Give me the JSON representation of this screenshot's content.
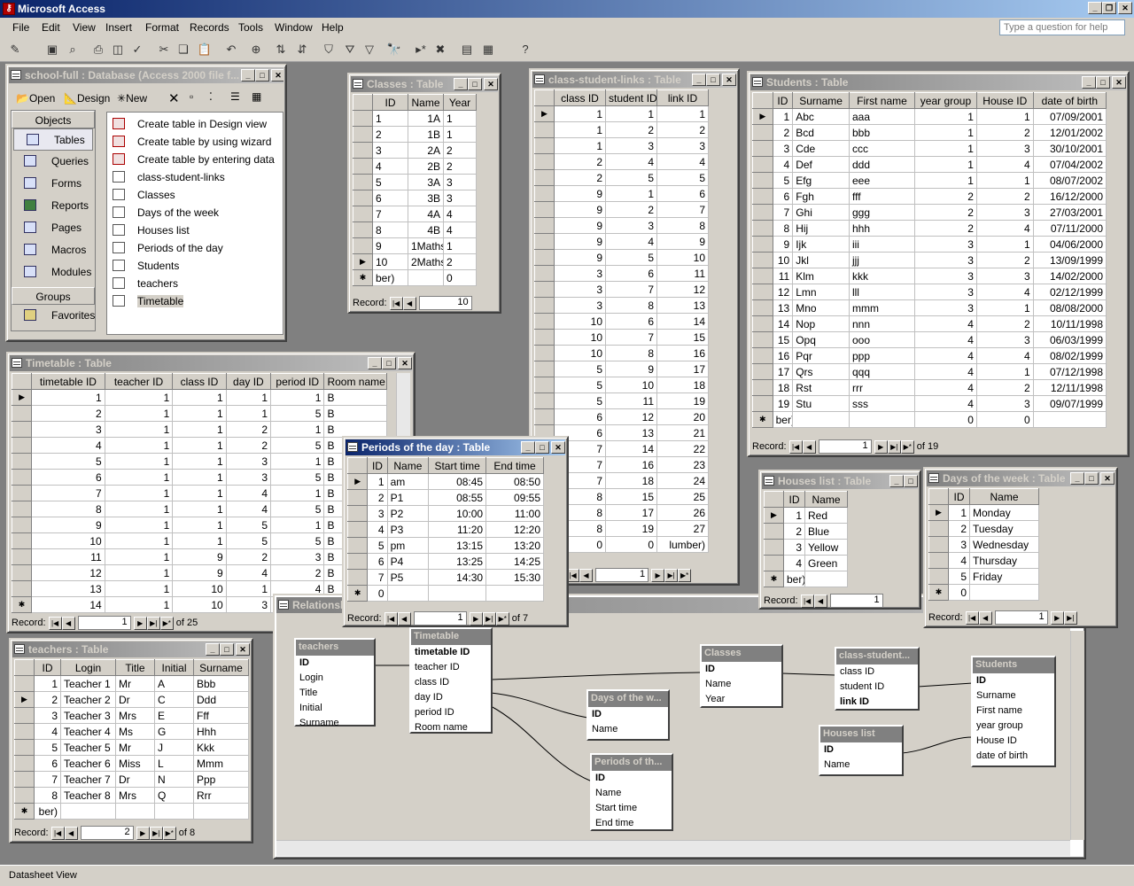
{
  "app": {
    "title": "Microsoft Access",
    "help_placeholder": "Type a question for help",
    "status": "Datasheet View"
  },
  "menu": [
    "File",
    "Edit",
    "View",
    "Insert",
    "Format",
    "Records",
    "Tools",
    "Window",
    "Help"
  ],
  "dbwindow": {
    "title": "school-full : Database (Access 2000 file f...",
    "toolbar": {
      "open": "Open",
      "design": "Design",
      "new": "New"
    },
    "objects_header": "Objects",
    "groups_header": "Groups",
    "objects": [
      "Tables",
      "Queries",
      "Forms",
      "Reports",
      "Pages",
      "Macros",
      "Modules"
    ],
    "favorites": "Favorites",
    "items": [
      "Create table in Design view",
      "Create table by using wizard",
      "Create table by entering data",
      "class-student-links",
      "Classes",
      "Days of the week",
      "Houses list",
      "Periods of the day",
      "Students",
      "teachers",
      "Timetable"
    ]
  },
  "classes": {
    "title": "Classes : Table",
    "headers": [
      "ID",
      "Name",
      "Year"
    ],
    "rows": [
      [
        "1",
        "1A",
        "1"
      ],
      [
        "2",
        "1B",
        "1"
      ],
      [
        "3",
        "2A",
        "2"
      ],
      [
        "4",
        "2B",
        "2"
      ],
      [
        "5",
        "3A",
        "3"
      ],
      [
        "6",
        "3B",
        "3"
      ],
      [
        "7",
        "4A",
        "4"
      ],
      [
        "8",
        "4B",
        "4"
      ],
      [
        "9",
        "1Maths",
        "1"
      ],
      [
        "10",
        "2Maths",
        "2"
      ],
      [
        "ber)",
        "",
        "0"
      ]
    ],
    "record_label": "Record:",
    "record": "10"
  },
  "csl": {
    "title": "class-student-links : Table",
    "headers": [
      "class ID",
      "student ID",
      "link ID"
    ],
    "rows": [
      [
        "1",
        "1",
        "1"
      ],
      [
        "1",
        "2",
        "2"
      ],
      [
        "1",
        "3",
        "3"
      ],
      [
        "2",
        "4",
        "4"
      ],
      [
        "2",
        "5",
        "5"
      ],
      [
        "9",
        "1",
        "6"
      ],
      [
        "9",
        "2",
        "7"
      ],
      [
        "9",
        "3",
        "8"
      ],
      [
        "9",
        "4",
        "9"
      ],
      [
        "9",
        "5",
        "10"
      ],
      [
        "3",
        "6",
        "11"
      ],
      [
        "3",
        "7",
        "12"
      ],
      [
        "3",
        "8",
        "13"
      ],
      [
        "10",
        "6",
        "14"
      ],
      [
        "10",
        "7",
        "15"
      ],
      [
        "10",
        "8",
        "16"
      ],
      [
        "5",
        "9",
        "17"
      ],
      [
        "5",
        "10",
        "18"
      ],
      [
        "5",
        "11",
        "19"
      ],
      [
        "6",
        "12",
        "20"
      ],
      [
        "6",
        "13",
        "21"
      ],
      [
        "7",
        "14",
        "22"
      ],
      [
        "7",
        "16",
        "23"
      ],
      [
        "7",
        "18",
        "24"
      ],
      [
        "8",
        "15",
        "25"
      ],
      [
        "8",
        "17",
        "26"
      ],
      [
        "8",
        "19",
        "27"
      ],
      [
        "0",
        "0",
        "lumber)"
      ]
    ],
    "record": "1"
  },
  "students": {
    "title": "Students : Table",
    "headers": [
      "ID",
      "Surname",
      "First name",
      "year group",
      "House ID",
      "date of birth"
    ],
    "rows": [
      [
        "1",
        "Abc",
        "aaa",
        "1",
        "1",
        "07/09/2001"
      ],
      [
        "2",
        "Bcd",
        "bbb",
        "1",
        "2",
        "12/01/2002"
      ],
      [
        "3",
        "Cde",
        "ccc",
        "1",
        "3",
        "30/10/2001"
      ],
      [
        "4",
        "Def",
        "ddd",
        "1",
        "4",
        "07/04/2002"
      ],
      [
        "5",
        "Efg",
        "eee",
        "1",
        "1",
        "08/07/2002"
      ],
      [
        "6",
        "Fgh",
        "fff",
        "2",
        "2",
        "16/12/2000"
      ],
      [
        "7",
        "Ghi",
        "ggg",
        "2",
        "3",
        "27/03/2001"
      ],
      [
        "8",
        "Hij",
        "hhh",
        "2",
        "4",
        "07/11/2000"
      ],
      [
        "9",
        "Ijk",
        "iii",
        "3",
        "1",
        "04/06/2000"
      ],
      [
        "10",
        "Jkl",
        "jjj",
        "3",
        "2",
        "13/09/1999"
      ],
      [
        "11",
        "Klm",
        "kkk",
        "3",
        "3",
        "14/02/2000"
      ],
      [
        "12",
        "Lmn",
        "lll",
        "3",
        "4",
        "02/12/1999"
      ],
      [
        "13",
        "Mno",
        "mmm",
        "3",
        "1",
        "08/08/2000"
      ],
      [
        "14",
        "Nop",
        "nnn",
        "4",
        "2",
        "10/11/1998"
      ],
      [
        "15",
        "Opq",
        "ooo",
        "4",
        "3",
        "06/03/1999"
      ],
      [
        "16",
        "Pqr",
        "ppp",
        "4",
        "4",
        "08/02/1999"
      ],
      [
        "17",
        "Qrs",
        "qqq",
        "4",
        "1",
        "07/12/1998"
      ],
      [
        "18",
        "Rst",
        "rrr",
        "4",
        "2",
        "12/11/1998"
      ],
      [
        "19",
        "Stu",
        "sss",
        "4",
        "3",
        "09/07/1999"
      ],
      [
        "ber)",
        "",
        "",
        "0",
        "0",
        ""
      ]
    ],
    "record_label": "Record:",
    "record": "1",
    "of": "of  19"
  },
  "timetable": {
    "title": "Timetable : Table",
    "headers": [
      "timetable ID",
      "teacher ID",
      "class ID",
      "day ID",
      "period ID",
      "Room name"
    ],
    "rows": [
      [
        "1",
        "1",
        "1",
        "1",
        "1",
        "B"
      ],
      [
        "2",
        "1",
        "1",
        "1",
        "5",
        "B"
      ],
      [
        "3",
        "1",
        "1",
        "2",
        "1",
        "B"
      ],
      [
        "4",
        "1",
        "1",
        "2",
        "5",
        "B"
      ],
      [
        "5",
        "1",
        "1",
        "3",
        "1",
        "B"
      ],
      [
        "6",
        "1",
        "1",
        "3",
        "5",
        "B"
      ],
      [
        "7",
        "1",
        "1",
        "4",
        "1",
        "B"
      ],
      [
        "8",
        "1",
        "1",
        "4",
        "5",
        "B"
      ],
      [
        "9",
        "1",
        "1",
        "5",
        "1",
        "B"
      ],
      [
        "10",
        "1",
        "1",
        "5",
        "5",
        "B"
      ],
      [
        "11",
        "1",
        "9",
        "2",
        "3",
        "B"
      ],
      [
        "12",
        "1",
        "9",
        "4",
        "2",
        "B"
      ],
      [
        "13",
        "1",
        "10",
        "1",
        "4",
        "B"
      ],
      [
        "14",
        "1",
        "10",
        "3",
        "4",
        "B"
      ]
    ],
    "record_label": "Record:",
    "record": "1",
    "of": "of  25"
  },
  "periods": {
    "title": "Periods of the day : Table",
    "headers": [
      "ID",
      "Name",
      "Start time",
      "End time"
    ],
    "rows": [
      [
        "1",
        "am",
        "08:45",
        "08:50"
      ],
      [
        "2",
        "P1",
        "08:55",
        "09:55"
      ],
      [
        "3",
        "P2",
        "10:00",
        "11:00"
      ],
      [
        "4",
        "P3",
        "11:20",
        "12:20"
      ],
      [
        "5",
        "pm",
        "13:15",
        "13:20"
      ],
      [
        "6",
        "P4",
        "13:25",
        "14:25"
      ],
      [
        "7",
        "P5",
        "14:30",
        "15:30"
      ],
      [
        "0",
        "",
        "",
        ""
      ]
    ],
    "record_label": "Record:",
    "record": "1",
    "of": "of  7"
  },
  "teachers": {
    "title": "teachers : Table",
    "headers": [
      "ID",
      "Login",
      "Title",
      "Initial",
      "Surname"
    ],
    "rows": [
      [
        "1",
        "Teacher 1",
        "Mr",
        "A",
        "Bbb"
      ],
      [
        "2",
        "Teacher 2",
        "Dr",
        "C",
        "Ddd"
      ],
      [
        "3",
        "Teacher 3",
        "Mrs",
        "E",
        "Fff"
      ],
      [
        "4",
        "Teacher 4",
        "Ms",
        "G",
        "Hhh"
      ],
      [
        "5",
        "Teacher 5",
        "Mr",
        "J",
        "Kkk"
      ],
      [
        "6",
        "Teacher 6",
        "Miss",
        "L",
        "Mmm"
      ],
      [
        "7",
        "Teacher 7",
        "Dr",
        "N",
        "Ppp"
      ],
      [
        "8",
        "Teacher 8",
        "Mrs",
        "Q",
        "Rrr"
      ],
      [
        "ber)",
        "",
        "",
        "",
        ""
      ]
    ],
    "record_label": "Record:",
    "record": "2",
    "of": "of  8"
  },
  "houses": {
    "title": "Houses list : Table",
    "headers": [
      "ID",
      "Name"
    ],
    "rows": [
      [
        "1",
        "Red"
      ],
      [
        "2",
        "Blue"
      ],
      [
        "3",
        "Yellow"
      ],
      [
        "4",
        "Green"
      ],
      [
        "ber)",
        ""
      ]
    ],
    "record_label": "Record:",
    "record": "1"
  },
  "days": {
    "title": "Days of the week : Table",
    "headers": [
      "ID",
      "Name"
    ],
    "rows": [
      [
        "1",
        "Monday"
      ],
      [
        "2",
        "Tuesday"
      ],
      [
        "3",
        "Wednesday"
      ],
      [
        "4",
        "Thursday"
      ],
      [
        "5",
        "Friday"
      ],
      [
        "0",
        ""
      ]
    ],
    "record_label": "Record:",
    "record": "1"
  },
  "relationships": {
    "title": "Relationships",
    "boxes": {
      "teachers": {
        "title": "teachers",
        "fields": [
          "ID",
          "Login",
          "Title",
          "Initial",
          "Surname"
        ]
      },
      "timetable": {
        "title": "Timetable",
        "fields": [
          "timetable ID",
          "teacher ID",
          "class ID",
          "day ID",
          "period ID",
          "Room name"
        ]
      },
      "classes": {
        "title": "Classes",
        "fields": [
          "ID",
          "Name",
          "Year"
        ]
      },
      "csl": {
        "title": "class-student...",
        "fields": [
          "class ID",
          "student ID",
          "link ID"
        ]
      },
      "students": {
        "title": "Students",
        "fields": [
          "ID",
          "Surname",
          "First name",
          "year group",
          "House ID",
          "date of birth"
        ]
      },
      "days": {
        "title": "Days of the w...",
        "fields": [
          "ID",
          "Name"
        ]
      },
      "periods": {
        "title": "Periods of th...",
        "fields": [
          "ID",
          "Name",
          "Start time",
          "End time"
        ]
      },
      "houses": {
        "title": "Houses list",
        "fields": [
          "ID",
          "Name"
        ]
      }
    }
  }
}
